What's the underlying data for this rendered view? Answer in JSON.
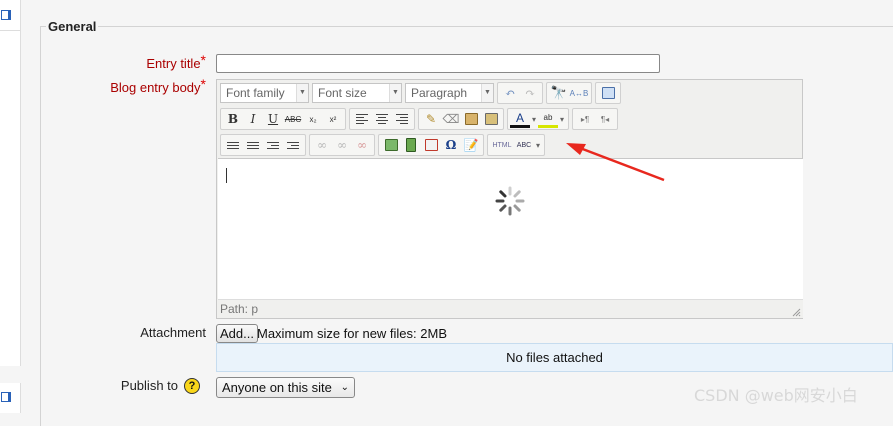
{
  "form": {
    "section_legend": "General",
    "entry_title_label": "Entry title",
    "entry_title_value": "",
    "body_label": "Blog entry body",
    "required_mark": "*",
    "attachment_label": "Attachment",
    "publish_label": "Publish to"
  },
  "editor": {
    "font_family": "Font family",
    "font_size": "Font size",
    "format": "Paragraph",
    "path_label": "Path: p",
    "toolbar": {
      "bold": "B",
      "italic": "I",
      "underline": "U",
      "strike": "ABC",
      "subscript": "x₂",
      "superscript": "x²",
      "font_color": "A",
      "highlight": "ab",
      "omega": "Ω",
      "html": "HTML",
      "spell": "ABC"
    }
  },
  "attachment": {
    "add_label": "Add...",
    "max_size": "Maximum size for new files: 2MB",
    "empty_message": "No files attached"
  },
  "publish": {
    "help_icon": "?",
    "selected": "Anyone on this site"
  },
  "watermark": "CSDN @web网安小白",
  "annotation": {
    "arrow_color": "#e8281e"
  }
}
